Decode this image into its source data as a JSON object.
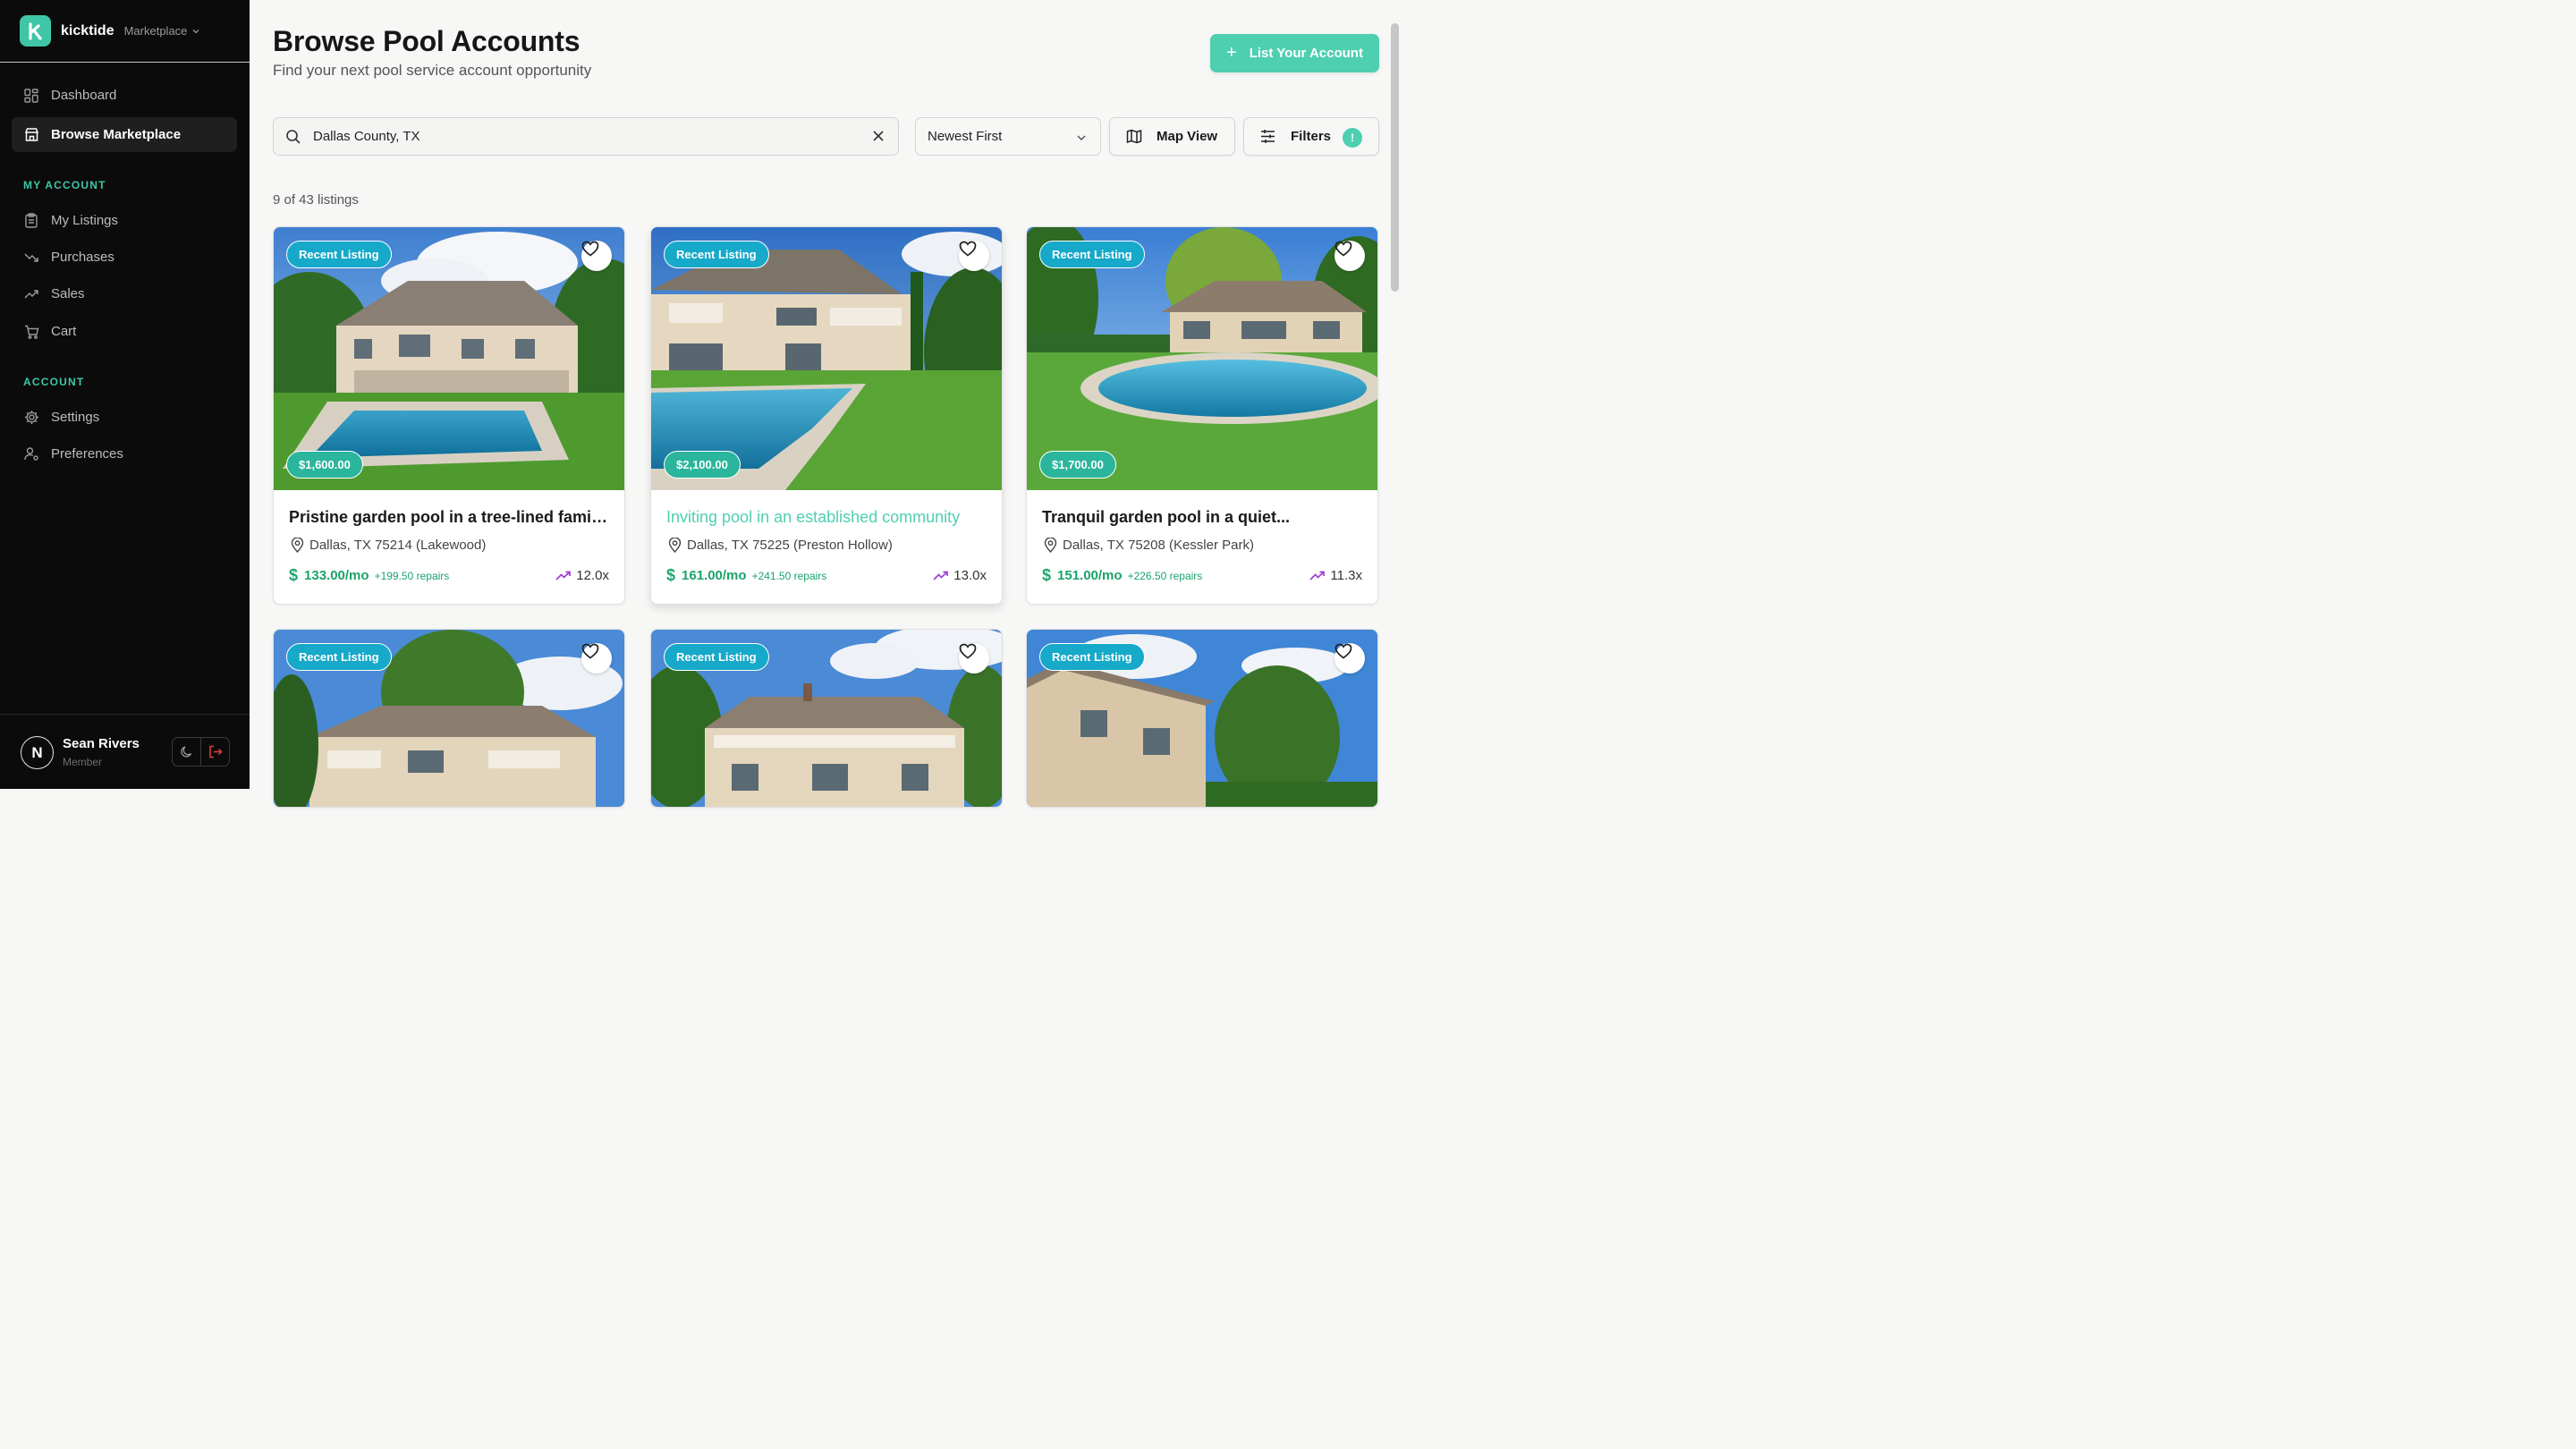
{
  "brand": {
    "name": "kicktide",
    "section": "Marketplace",
    "logo_letter": "k",
    "accent": "#3ec6a6"
  },
  "nav": {
    "top": [
      {
        "label": "Dashboard",
        "icon": "grid-icon"
      },
      {
        "label": "Browse Marketplace",
        "icon": "store-icon",
        "active": true
      }
    ],
    "sections": [
      {
        "title": "MY ACCOUNT",
        "items": [
          {
            "label": "My Listings",
            "icon": "clipboard-icon"
          },
          {
            "label": "Purchases",
            "icon": "trend-down-icon"
          },
          {
            "label": "Sales",
            "icon": "trend-up-icon"
          },
          {
            "label": "Cart",
            "icon": "cart-icon"
          }
        ]
      },
      {
        "title": "ACCOUNT",
        "items": [
          {
            "label": "Settings",
            "icon": "gear-icon"
          },
          {
            "label": "Preferences",
            "icon": "user-settings-icon"
          }
        ]
      }
    ]
  },
  "user": {
    "initial": "N",
    "name": "Sean Rivers",
    "role": "Member"
  },
  "header": {
    "title": "Browse Pool Accounts",
    "subtitle": "Find your next pool service account opportunity",
    "cta": "List Your Account"
  },
  "toolbar": {
    "search_value": "Dallas County, TX",
    "sort": "Newest First",
    "map_label": "Map View",
    "filters_label": "Filters",
    "filters_badge": "!"
  },
  "results": {
    "count_text": "9 of 43 listings"
  },
  "listings": [
    {
      "tag": "Recent Listing",
      "price": "$1,600.00",
      "title": "Pristine garden pool in a tree-lined family...",
      "location": "Dallas, TX 75214 (Lakewood)",
      "monthly": "133.00/mo",
      "repairs": "+199.50 repairs",
      "multiple": "12.0x"
    },
    {
      "tag": "Recent Listing",
      "price": "$2,100.00",
      "title": "Inviting pool in an established community",
      "location": "Dallas, TX 75225 (Preston Hollow)",
      "monthly": "161.00/mo",
      "repairs": "+241.50 repairs",
      "multiple": "13.0x"
    },
    {
      "tag": "Recent Listing",
      "price": "$1,700.00",
      "title": "Tranquil garden pool in a quiet...",
      "location": "Dallas, TX 75208 (Kessler Park)",
      "monthly": "151.00/mo",
      "repairs": "+226.50 repairs",
      "multiple": "11.3x"
    },
    {
      "tag": "Recent Listing"
    },
    {
      "tag": "Recent Listing"
    },
    {
      "tag": "Recent Listing"
    }
  ],
  "colors": {
    "accent": "#4ecfb0",
    "tag": "#16a9c9",
    "price": "#2bb59c",
    "money": "#1aa36b",
    "multiple_icon": "#9b3fd6"
  }
}
